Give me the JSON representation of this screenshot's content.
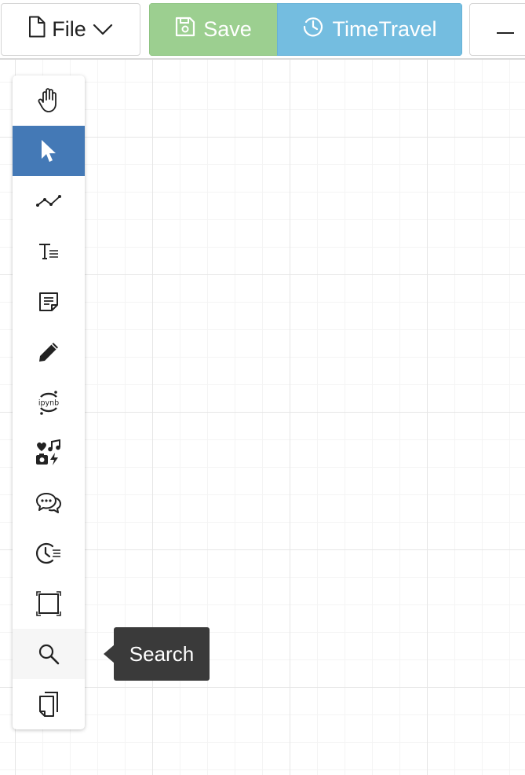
{
  "toolbar": {
    "file_label": "File",
    "save_label": "Save",
    "timetravel_label": "TimeTravel",
    "colors": {
      "save_bg": "#9ccf90",
      "timetravel_bg": "#74bde0"
    }
  },
  "palette": {
    "active_tool": "select",
    "hovered_tool": "search",
    "active_color": "#4479b6",
    "tools": [
      {
        "id": "pan",
        "icon": "hand-icon"
      },
      {
        "id": "select",
        "icon": "cursor-arrow-icon"
      },
      {
        "id": "connector",
        "icon": "line-chart-icon"
      },
      {
        "id": "text",
        "icon": "text-format-icon"
      },
      {
        "id": "note",
        "icon": "note-icon"
      },
      {
        "id": "pen",
        "icon": "pencil-icon"
      },
      {
        "id": "ipynb",
        "icon": "jupyter-notebook-icon",
        "icon_text": "ipynb"
      },
      {
        "id": "media",
        "icon": "media-icon"
      },
      {
        "id": "chat",
        "icon": "chat-bubbles-icon"
      },
      {
        "id": "history",
        "icon": "history-clock-icon"
      },
      {
        "id": "frame",
        "icon": "frame-icon"
      },
      {
        "id": "search",
        "icon": "search-icon"
      },
      {
        "id": "pages",
        "icon": "pages-icon"
      }
    ]
  },
  "tooltip": {
    "text": "Search"
  }
}
